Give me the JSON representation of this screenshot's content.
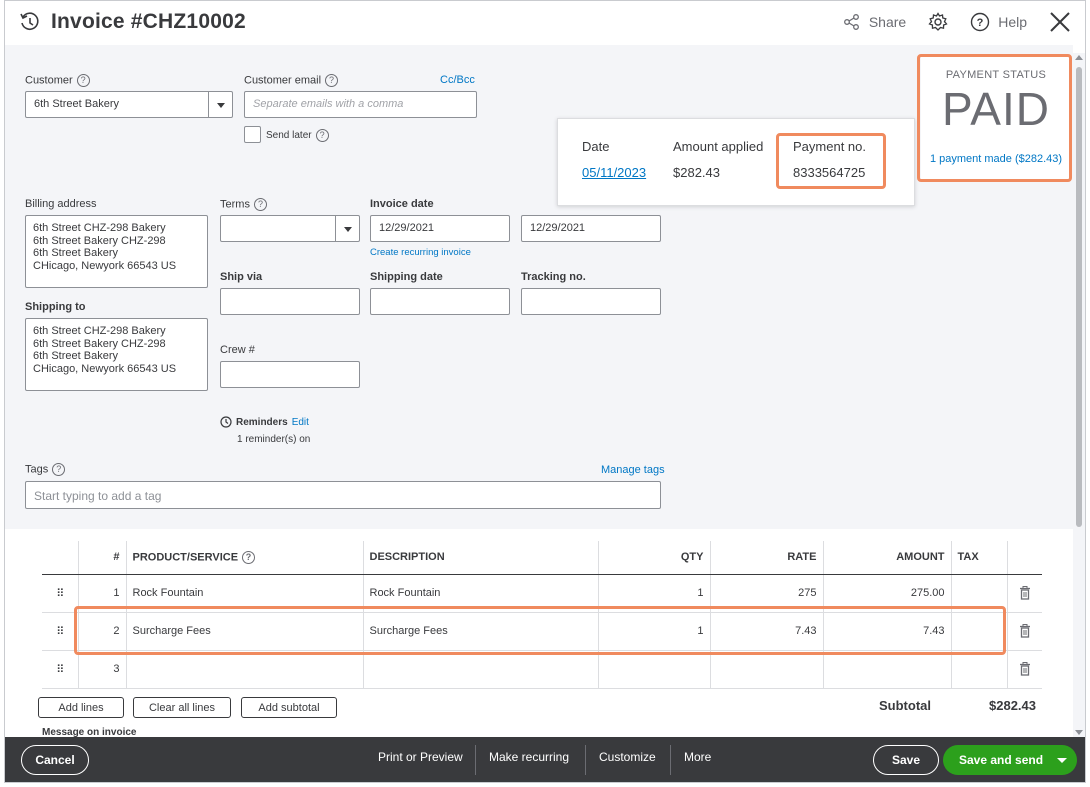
{
  "header": {
    "title": "Invoice #CHZ10002",
    "share_label": "Share",
    "help_label": "Help"
  },
  "customer": {
    "label": "Customer",
    "value": "6th Street Bakery",
    "email_label": "Customer email",
    "email_placeholder": "Separate emails with a comma",
    "cc_bcc": "Cc/Bcc",
    "send_later": "Send later"
  },
  "payment_popover": {
    "date_header": "Date",
    "amount_header": "Amount applied",
    "payment_no_header": "Payment no.",
    "date": "05/11/2023",
    "amount": "$282.43",
    "payment_no": "8333564725"
  },
  "payment_status": {
    "label": "PAYMENT STATUS",
    "value": "PAID",
    "link": "1 payment made ($282.43)"
  },
  "billing": {
    "label": "Billing address",
    "lines": [
      "6th Street CHZ-298 Bakery",
      "6th Street Bakery CHZ-298",
      "6th Street Bakery",
      "CHicago, Newyork  66543 US"
    ]
  },
  "shipping": {
    "label": "Shipping to",
    "lines": [
      "6th Street CHZ-298 Bakery",
      "6th Street Bakery CHZ-298",
      "6th Street Bakery",
      "CHicago, Newyork  66543 US"
    ]
  },
  "terms": {
    "label": "Terms",
    "value": ""
  },
  "invoice_date": {
    "label": "Invoice date",
    "value": "12/29/2021",
    "due_value": "12/29/2021",
    "recurring_link": "Create recurring invoice"
  },
  "ship_via": {
    "label": "Ship via"
  },
  "shipping_date": {
    "label": "Shipping date"
  },
  "tracking": {
    "label": "Tracking no."
  },
  "crew": {
    "label": "Crew #"
  },
  "reminders": {
    "label": "Reminders",
    "edit": "Edit",
    "status": "1 reminder(s) on"
  },
  "tags": {
    "label": "Tags",
    "manage": "Manage tags",
    "placeholder": "Start typing to add a tag"
  },
  "table": {
    "headers": {
      "num": "#",
      "product": "PRODUCT/SERVICE",
      "description": "DESCRIPTION",
      "qty": "QTY",
      "rate": "RATE",
      "amount": "AMOUNT",
      "tax": "TAX"
    },
    "rows": [
      {
        "num": "1",
        "product": "Rock Fountain",
        "description": "Rock Fountain",
        "qty": "1",
        "rate": "275",
        "amount": "275.00"
      },
      {
        "num": "2",
        "product": "Surcharge Fees",
        "description": "Surcharge Fees",
        "qty": "1",
        "rate": "7.43",
        "amount": "7.43"
      },
      {
        "num": "3",
        "product": "",
        "description": "",
        "qty": "",
        "rate": "",
        "amount": ""
      }
    ]
  },
  "line_actions": {
    "add_lines": "Add lines",
    "clear_all": "Clear all lines",
    "add_subtotal": "Add subtotal"
  },
  "subtotal": {
    "label": "Subtotal",
    "value": "$282.43"
  },
  "message_label": "Message on invoice",
  "footer": {
    "cancel": "Cancel",
    "print": "Print or Preview",
    "recurring": "Make recurring",
    "customize": "Customize",
    "more": "More",
    "save": "Save",
    "save_send": "Save and send"
  },
  "colors": {
    "accent": "#0077c5",
    "highlight": "#f08a5e",
    "success": "#2ca01c",
    "footer": "#393a3d"
  }
}
